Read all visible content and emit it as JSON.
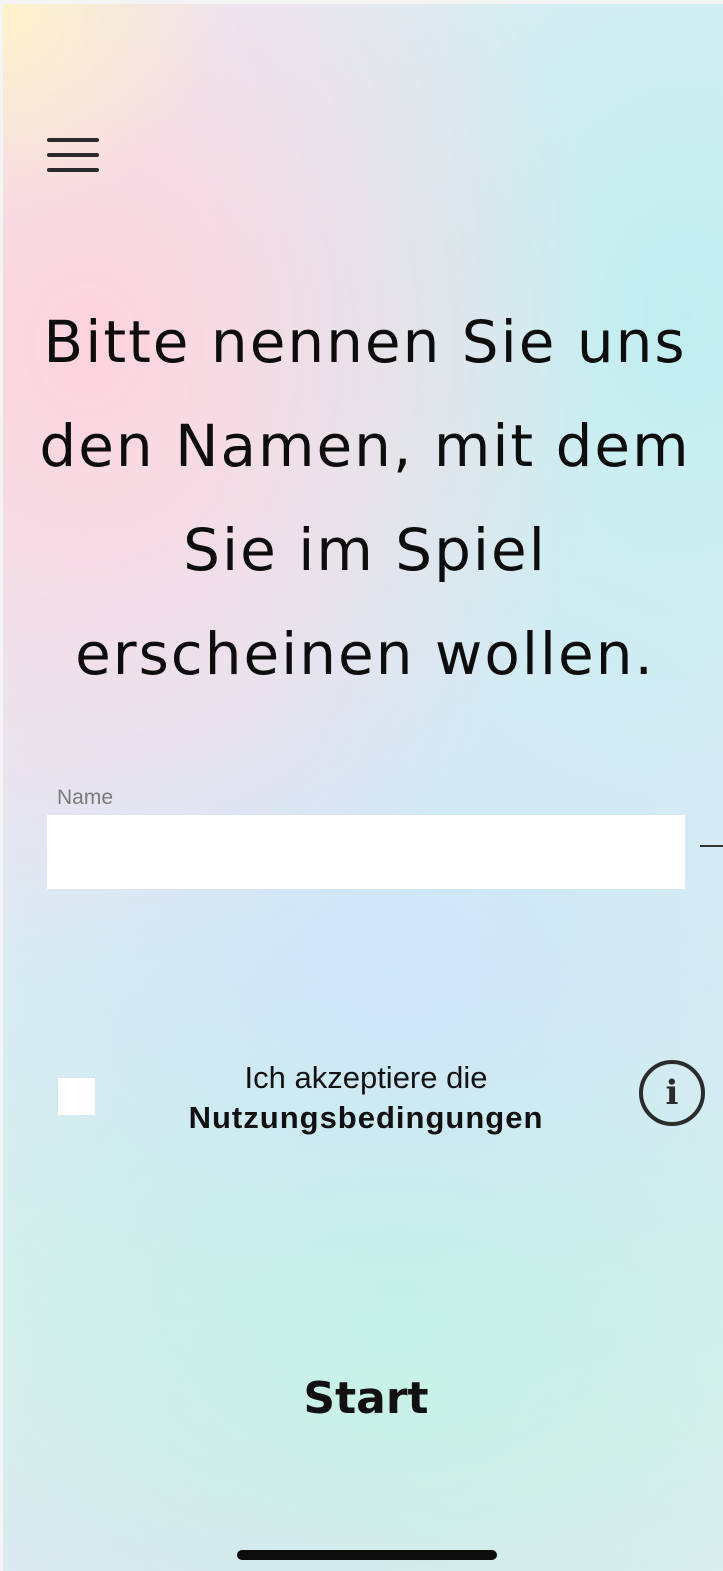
{
  "header": {
    "menu_icon": "hamburger-menu-icon"
  },
  "main": {
    "headline": "Bitte nennen Sie uns den Namen, mit dem Sie im Spiel erscheinen wollen."
  },
  "name_field": {
    "label": "Name",
    "value": "",
    "placeholder": ""
  },
  "terms": {
    "prefix": "Ich akzeptiere die",
    "link_label": "Nutzungsbedingungen",
    "checked": false,
    "info_icon": "info-icon",
    "info_glyph": "i"
  },
  "actions": {
    "start_label": "Start"
  },
  "colors": {
    "text": "#111111",
    "input_background": "#ffffff",
    "label": "#7a7a7a"
  }
}
